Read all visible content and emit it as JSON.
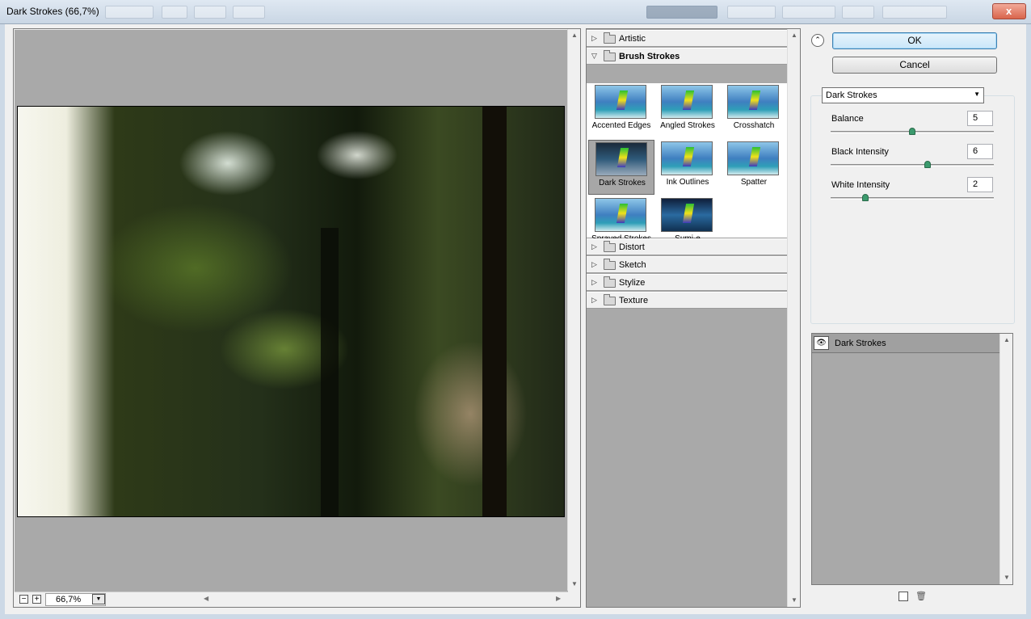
{
  "window": {
    "title": "Dark Strokes (66,7%)"
  },
  "preview": {
    "zoom_value": "66,7%",
    "zoom_out": "−",
    "zoom_in": "+"
  },
  "filter_categories": [
    {
      "label": "Artistic",
      "expanded": false
    },
    {
      "label": "Brush Strokes",
      "expanded": true
    },
    {
      "label": "Distort",
      "expanded": false
    },
    {
      "label": "Sketch",
      "expanded": false
    },
    {
      "label": "Stylize",
      "expanded": false
    },
    {
      "label": "Texture",
      "expanded": false
    }
  ],
  "brush_strokes": [
    {
      "label": "Accented Edges"
    },
    {
      "label": "Angled Strokes"
    },
    {
      "label": "Crosshatch"
    },
    {
      "label": "Dark Strokes",
      "selected": true
    },
    {
      "label": "Ink Outlines"
    },
    {
      "label": "Spatter"
    },
    {
      "label": "Sprayed Strokes"
    },
    {
      "label": "Sumi-e"
    }
  ],
  "buttons": {
    "ok": "OK",
    "cancel": "Cancel"
  },
  "filter_select": {
    "value": "Dark Strokes"
  },
  "params": [
    {
      "label": "Balance",
      "value": "5",
      "fraction": 0.5
    },
    {
      "label": "Black Intensity",
      "value": "6",
      "fraction": 0.6
    },
    {
      "label": "White Intensity",
      "value": "2",
      "fraction": 0.2
    }
  ],
  "layers": [
    {
      "name": "Dark Strokes",
      "visible": true
    }
  ],
  "icons": {
    "collapse": "chevron-up-icon",
    "eye": "eye-icon",
    "new_layer": "new-layer-icon",
    "trash": "trash-icon",
    "close": "close-icon"
  },
  "colors": {
    "ok_border": "#3c7fb1",
    "slider_knob": "#3b9a6d",
    "panel_bg": "#a9a9a9"
  }
}
